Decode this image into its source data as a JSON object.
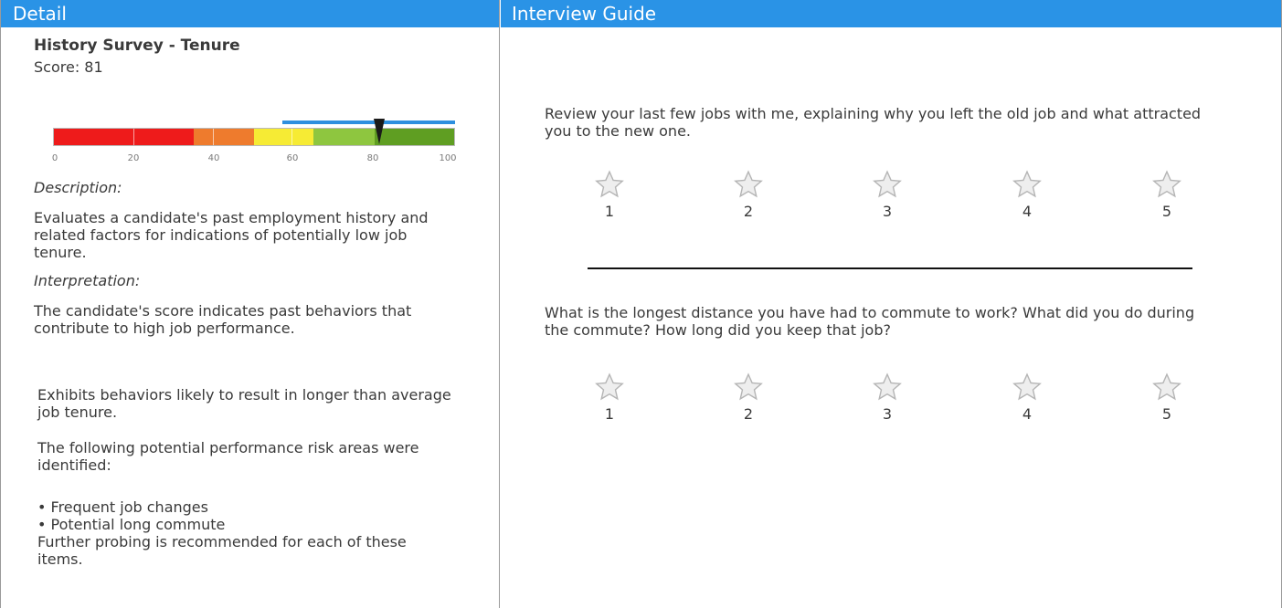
{
  "panels": {
    "detail_title": "Detail",
    "guide_title": "Interview Guide"
  },
  "detail": {
    "survey_title": "History Survey - Tenure",
    "score_label": "Score: 81",
    "score_value": 81,
    "gauge": {
      "min": 0,
      "max": 100,
      "ticks": [
        "0",
        "20",
        "40",
        "60",
        "80",
        "100"
      ],
      "segments": [
        {
          "from": 0,
          "to": 35,
          "color": "#ee1b1b"
        },
        {
          "from": 35,
          "to": 50,
          "color": "#ee7b2d"
        },
        {
          "from": 50,
          "to": 65,
          "color": "#f6eb34"
        },
        {
          "from": 65,
          "to": 80,
          "color": "#8ec63f"
        },
        {
          "from": 80,
          "to": 100,
          "color": "#5f9e22"
        }
      ],
      "range_from": 57,
      "range_to": 100,
      "range_color": "#2d8fdf"
    },
    "description_label": "Description:",
    "description_text": "Evaluates a candidate's past employment history and related factors for indications of potentially low job tenure.",
    "interpretation_label": "Interpretation:",
    "interpretation_text": "The candidate's score indicates past behaviors that contribute to high job performance.",
    "behavior_text": "Exhibits behaviors likely to result in longer than average job tenure.",
    "risk_intro": "The following potential performance risk areas were identified:",
    "risk_items": [
      "• Frequent job changes",
      "• Potential long commute"
    ],
    "risk_outro": "Further probing is recommended for each of these items."
  },
  "guide": {
    "questions": [
      {
        "text": "Review your last few jobs with me, explaining why you left the old job and what attracted you to the new one.",
        "ratings": [
          "1",
          "2",
          "3",
          "4",
          "5"
        ]
      },
      {
        "text": "What is the longest distance you have had to commute to work? What did you do during the commute? How long did you keep that job?",
        "ratings": [
          "1",
          "2",
          "3",
          "4",
          "5"
        ]
      }
    ],
    "star_icon": "star-outline-icon"
  },
  "colors": {
    "header_bg": "#2a93e6",
    "star_fill": "#eeeeee",
    "star_stroke": "#b5b5b5"
  }
}
